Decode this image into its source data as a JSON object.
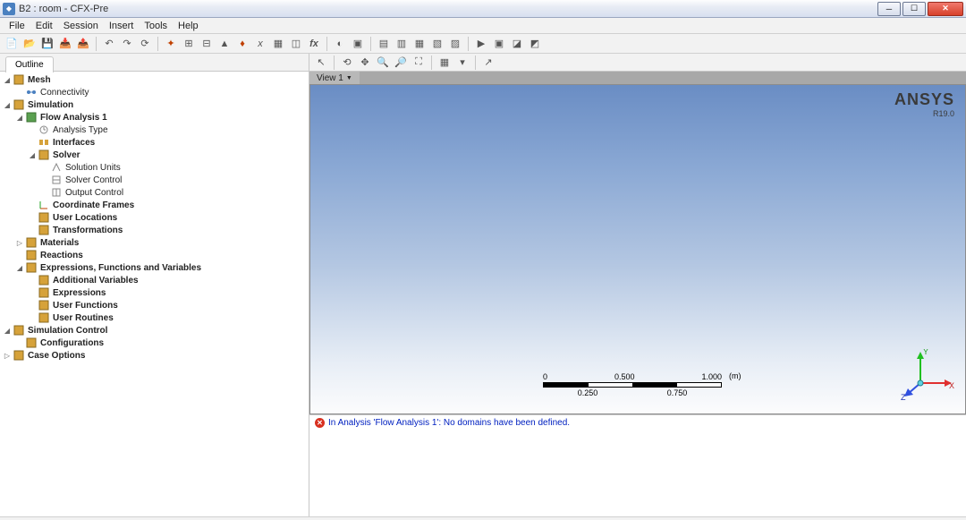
{
  "window": {
    "title": "B2 : room - CFX-Pre"
  },
  "menu": {
    "items": [
      "File",
      "Edit",
      "Session",
      "Insert",
      "Tools",
      "Help"
    ]
  },
  "tabs": {
    "outline": "Outline"
  },
  "tree": {
    "mesh": "Mesh",
    "connectivity": "Connectivity",
    "simulation": "Simulation",
    "flow": "Flow Analysis 1",
    "analysis_type": "Analysis Type",
    "interfaces": "Interfaces",
    "solver": "Solver",
    "solution_units": "Solution Units",
    "solver_control": "Solver Control",
    "output_control": "Output Control",
    "coord_frames": "Coordinate Frames",
    "user_locations": "User Locations",
    "transformations": "Transformations",
    "materials": "Materials",
    "reactions": "Reactions",
    "expressions_group": "Expressions, Functions and Variables",
    "additional_vars": "Additional Variables",
    "expressions": "Expressions",
    "user_functions": "User Functions",
    "user_routines": "User Routines",
    "sim_control": "Simulation Control",
    "configurations": "Configurations",
    "case_options": "Case Options"
  },
  "view": {
    "tab": "View 1"
  },
  "ruler": {
    "t0": "0",
    "t1": "0.500",
    "t2": "1.000",
    "b0": "0.250",
    "b1": "0.750",
    "unit": "(m)"
  },
  "logo": {
    "brand": "ANSYS",
    "version": "R19.0"
  },
  "triad": {
    "x": "X",
    "y": "Y",
    "z": "Z"
  },
  "message": {
    "text": "In Analysis 'Flow Analysis 1': No domains have been defined."
  }
}
